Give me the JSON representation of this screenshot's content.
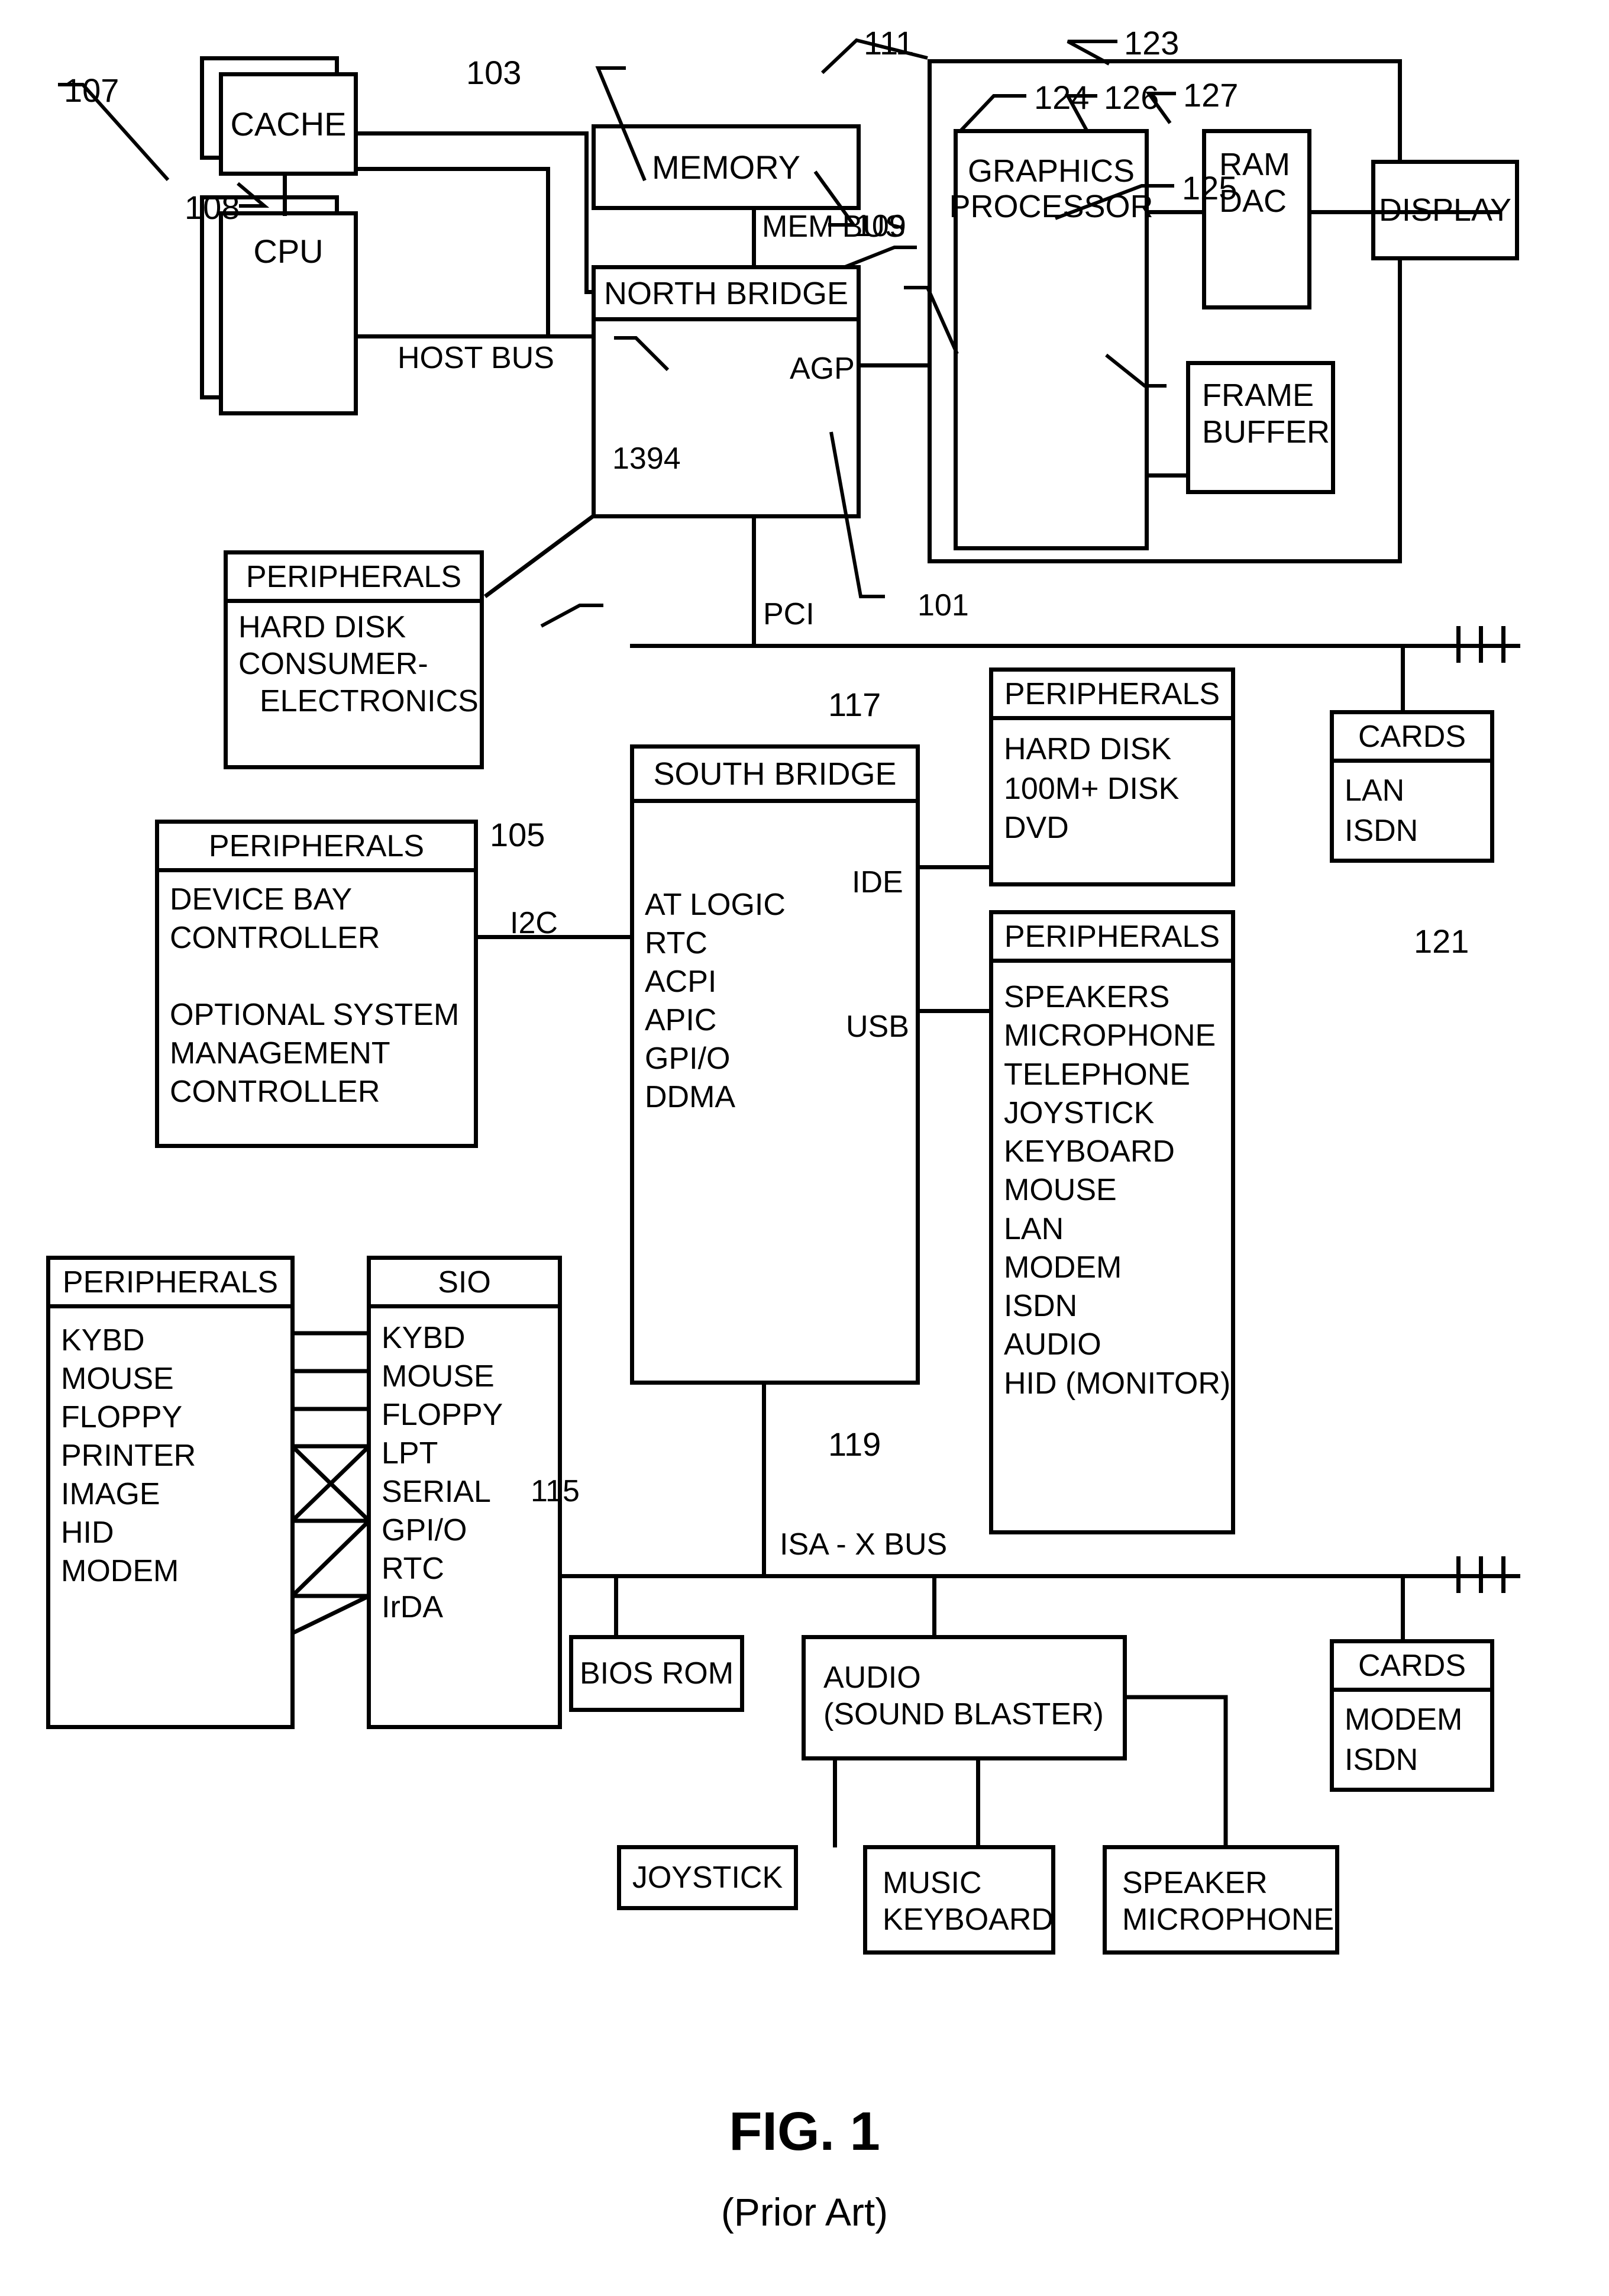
{
  "figure": {
    "caption_main": "FIG. 1",
    "caption_sub": "(Prior Art)"
  },
  "blocks": {
    "cache": {
      "label": "CACHE"
    },
    "cpu": {
      "label": "CPU"
    },
    "memory": {
      "label": "MEMORY"
    },
    "north_bridge": {
      "label": "NORTH BRIDGE",
      "port_1394": "1394",
      "port_agp": "AGP"
    },
    "south_bridge": {
      "label": "SOUTH BRIDGE",
      "port_ide": "IDE",
      "port_usb": "USB",
      "items": [
        "AT LOGIC",
        "RTC",
        "ACPI",
        "APIC",
        "GPI/O",
        "DDMA"
      ]
    },
    "graphics_processor": {
      "label": "GRAPHICS PROCESSOR"
    },
    "ram_dac": {
      "label": "RAM DAC"
    },
    "frame_buffer": {
      "label": "FRAME BUFFER"
    },
    "display": {
      "label": "DISPLAY"
    },
    "peripherals_1394": {
      "title": "PERIPHERALS",
      "items": [
        "HARD DISK",
        "CONSUMER-",
        "ELECTRONICS"
      ]
    },
    "peripherals_i2c": {
      "title": "PERIPHERALS",
      "items": [
        "DEVICE BAY",
        "CONTROLLER",
        "",
        "OPTIONAL SYSTEM",
        "MANAGEMENT",
        "CONTROLLER"
      ]
    },
    "peripherals_ide": {
      "title": "PERIPHERALS",
      "items": [
        "HARD DISK",
        "100M+ DISK",
        "DVD"
      ]
    },
    "peripherals_usb": {
      "title": "PERIPHERALS",
      "items": [
        "SPEAKERS",
        "MICROPHONE",
        "TELEPHONE",
        "JOYSTICK",
        "KEYBOARD",
        "MOUSE",
        "LAN",
        "MODEM",
        "ISDN",
        "AUDIO",
        "HID (MONITOR)"
      ]
    },
    "cards_pci": {
      "title": "CARDS",
      "items": [
        "LAN",
        "ISDN"
      ]
    },
    "cards_isa": {
      "title": "CARDS",
      "items": [
        "MODEM",
        "ISDN"
      ]
    },
    "peripherals_sio": {
      "title": "PERIPHERALS",
      "items": [
        "KYBD",
        "MOUSE",
        "FLOPPY",
        "PRINTER",
        "IMAGE",
        "HID",
        "MODEM"
      ]
    },
    "sio": {
      "title": "SIO",
      "items": [
        "KYBD",
        "MOUSE",
        "FLOPPY",
        "LPT",
        "SERIAL",
        "GPI/O",
        "RTC",
        "IrDA"
      ]
    },
    "bios_rom": {
      "label": "BIOS ROM"
    },
    "audio": {
      "label": "AUDIO",
      "label2": "(SOUND BLASTER)"
    },
    "joystick": {
      "label": "JOYSTICK"
    },
    "music_keyboard": {
      "label": "MUSIC",
      "label2": "KEYBOARD"
    },
    "speaker_microphone": {
      "label": "SPEAKER",
      "label2": "MICROPHONE"
    }
  },
  "bus_labels": {
    "mem_bus": "MEM BUS",
    "host_bus": "HOST BUS",
    "pci": "PCI",
    "i2c": "I2C",
    "isa_x_bus": "ISA - X BUS"
  },
  "reference_numerals": {
    "n101": "101",
    "n103": "103",
    "n105": "105",
    "n107": "107",
    "n108": "108",
    "n109": "109",
    "n111": "111",
    "n115": "115",
    "n117": "117",
    "n119": "119",
    "n121": "121",
    "n123": "123",
    "n124": "124",
    "n125": "125",
    "n126": "126",
    "n127": "127"
  },
  "style": {
    "ink": "#000000",
    "paper": "#ffffff"
  }
}
